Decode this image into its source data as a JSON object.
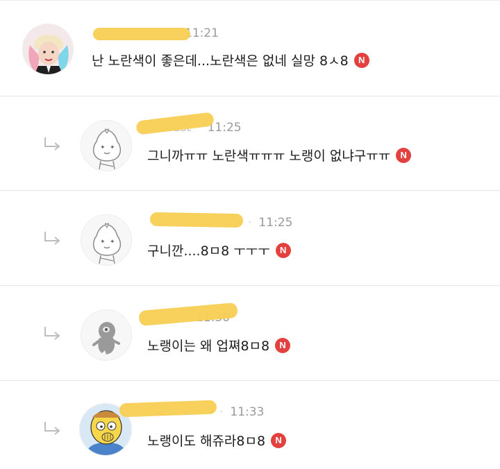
{
  "comments": [
    {
      "nickname": "",
      "time": "11:21",
      "text": "난 노란색이 좋은데...노란색은 없네 실망 8ㅅ8",
      "badge": "N",
      "is_reply": false,
      "avatar": "harley-quinn-avatar"
    },
    {
      "nickname": "beast",
      "time": "11:25",
      "text": "그니까ㅠㅠ 노란색ㅠㅠㅠ 노랭이 없냐구ㅠㅠ",
      "badge": "N",
      "is_reply": true,
      "avatar": "apeach-sketch-avatar"
    },
    {
      "nickname": "",
      "time": "11:25",
      "text": "구니깐....8ㅁ8 ㅜㅜㅜ",
      "badge": "N",
      "is_reply": true,
      "avatar": "apeach-sketch-avatar"
    },
    {
      "nickname": "",
      "time": "11:30",
      "text": "노랭이는 왜 업쪄8ㅁ8",
      "badge": "N",
      "is_reply": true,
      "avatar": "gray-figure-avatar"
    },
    {
      "nickname": "",
      "time": "11:33",
      "text": "노랭이도 해쥬라8ㅁ8",
      "badge": "N",
      "is_reply": true,
      "avatar": "ralph-wiggum-avatar"
    }
  ],
  "colors": {
    "badge": "#e3413f",
    "scribble": "#f7cf55",
    "divider": "#e6e6e6"
  },
  "icons": {
    "reply": "reply-arrow-icon",
    "badge": "new-badge-icon"
  }
}
